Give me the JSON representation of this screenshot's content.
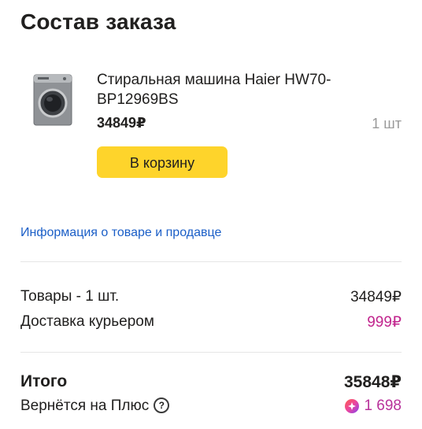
{
  "page": {
    "title": "Состав заказа"
  },
  "product": {
    "name": "Стиральная машина Haier HW70-BP12969BS",
    "price": "34849₽",
    "quantity": "1 шт",
    "image_icon": "washing-machine-icon",
    "cart_button_label": "В корзину"
  },
  "info_link": {
    "label": "Информация о товаре и продавце",
    "color": "#1a5ec7"
  },
  "summary": {
    "goods_label": "Товары - 1 шт.",
    "goods_value": "34849₽",
    "delivery_label": "Доставка курьером",
    "delivery_value": "999₽",
    "total_label": "Итого",
    "total_value": "35848₽",
    "plus_label": "Вернётся на Плюс",
    "plus_value": "1 698",
    "help_icon": "question-circle-icon",
    "plus_icon": "plus-points-icon"
  },
  "colors": {
    "accent_button": "#fed42b",
    "delivery_price": "#c1248d",
    "plus_points": "#b8329b"
  }
}
